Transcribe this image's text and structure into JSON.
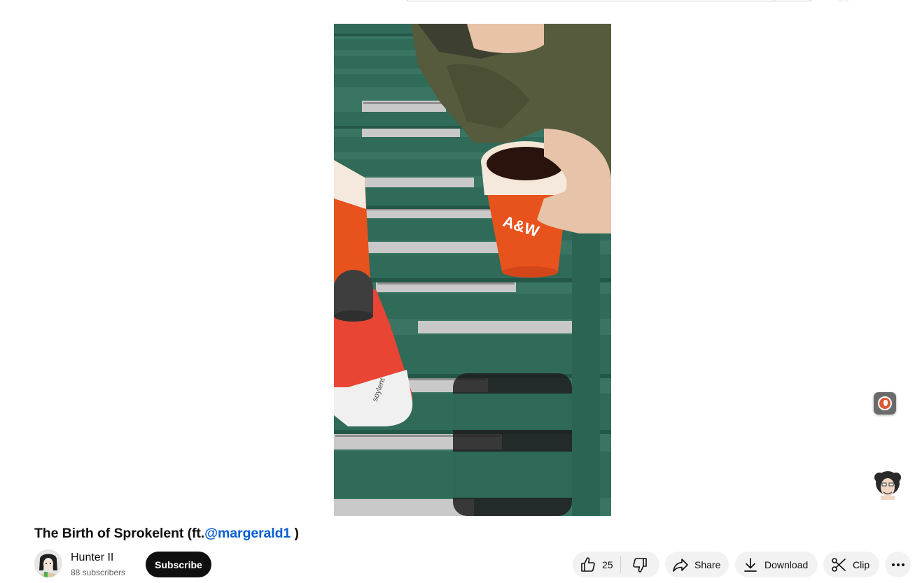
{
  "video": {
    "title_text": "The Birth of Sprokelent (ft.",
    "title_mention": "@margerald1",
    "title_end": " )"
  },
  "channel": {
    "name": "Hunter II",
    "subscribers": "88 subscribers",
    "subscribe_label": "Subscribe"
  },
  "actions": {
    "like_count": "25",
    "share_label": "Share",
    "download_label": "Download",
    "clip_label": "Clip"
  },
  "icons": {
    "like": "thumbs-up-icon",
    "dislike": "thumbs-down-icon",
    "share": "share-arrow-icon",
    "download": "download-icon",
    "clip": "scissors-icon",
    "more": "more-horizontal-icon",
    "extension": "duckduckgo-icon"
  },
  "colors": {
    "subscribe_bg": "#0f0f0f",
    "mention_link": "#065fd4",
    "pill_bg": "#f2f2f2",
    "bench_green": "#2f6b58",
    "cup_orange": "#e8521c"
  }
}
